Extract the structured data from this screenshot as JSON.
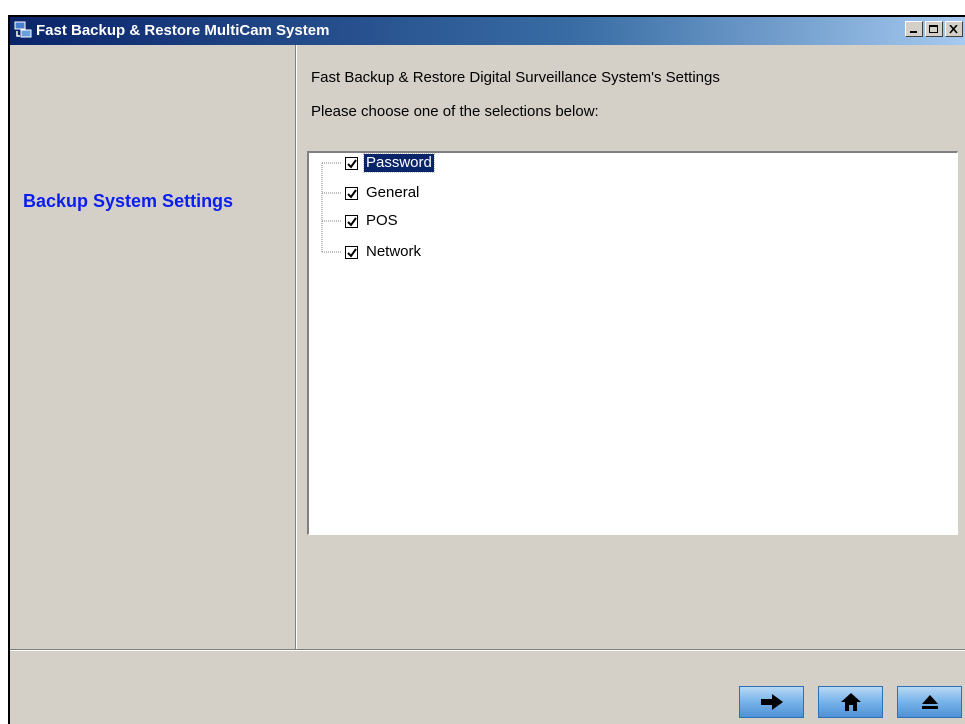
{
  "window": {
    "title": "Fast Backup & Restore MultiCam System",
    "controls": {
      "minimize": "minimize-icon",
      "maximize": "maximize-icon",
      "close": "close-icon"
    }
  },
  "sidebar": {
    "label": "Backup System Settings",
    "label_color": "#0b1ef2"
  },
  "main": {
    "heading": "Fast Backup & Restore Digital Surveillance System's Settings",
    "instruction": "Please choose one of the selections below:",
    "tree": {
      "items": [
        {
          "label": "Password",
          "checked": true,
          "selected": true
        },
        {
          "label": "General",
          "checked": true,
          "selected": false
        },
        {
          "label": "POS",
          "checked": true,
          "selected": false
        },
        {
          "label": "Network",
          "checked": true,
          "selected": false
        }
      ]
    }
  },
  "footer": {
    "buttons": [
      {
        "icon": "arrow-right-icon"
      },
      {
        "icon": "home-icon"
      },
      {
        "icon": "eject-icon"
      }
    ],
    "button_color": "#4d92d6"
  }
}
